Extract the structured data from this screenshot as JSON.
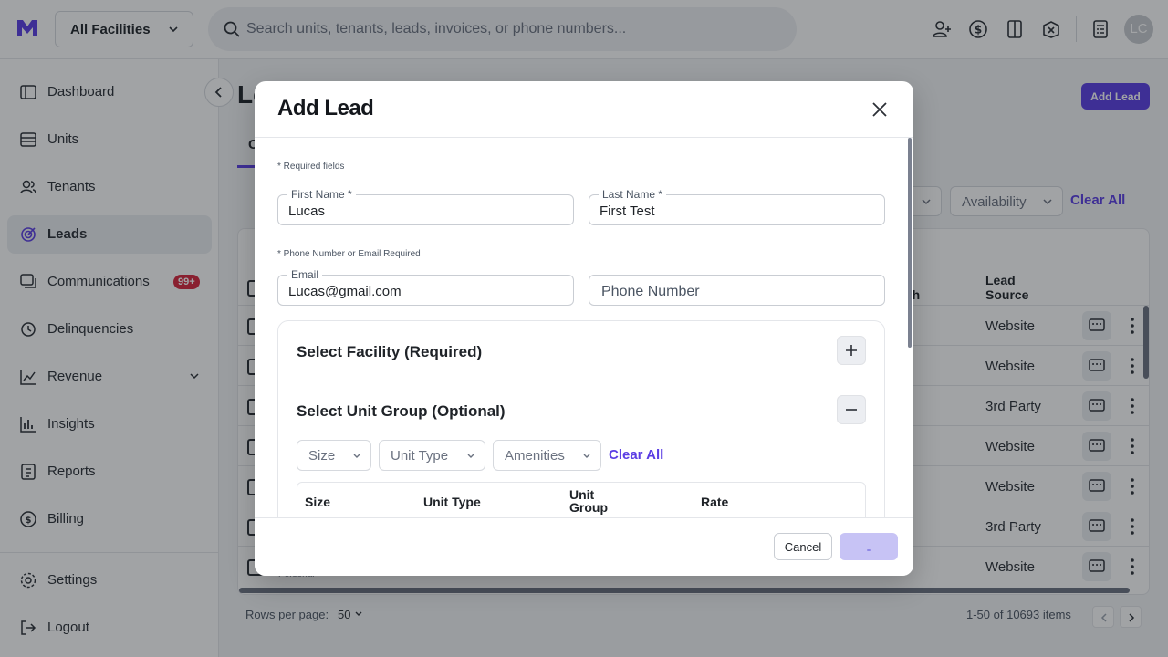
{
  "topbar": {
    "facility_select": "All Facilities",
    "search_placeholder": "Search units, tenants, leads, invoices, or phone numbers...",
    "user_initials": "LC",
    "icons": [
      "add-person-icon",
      "dollar-refresh-icon",
      "door-icon",
      "lock-box-icon",
      "calculator-icon"
    ]
  },
  "sidebar": {
    "items": [
      {
        "label": "Dashboard",
        "icon": "dashboard-icon"
      },
      {
        "label": "Units",
        "icon": "units-icon"
      },
      {
        "label": "Tenants",
        "icon": "tenants-icon"
      },
      {
        "label": "Leads",
        "icon": "leads-icon",
        "active": true
      },
      {
        "label": "Communications",
        "icon": "chat-icon",
        "badge": "99+"
      },
      {
        "label": "Delinquencies",
        "icon": "alarm-icon"
      },
      {
        "label": "Revenue",
        "icon": "trend-icon"
      },
      {
        "label": "Insights",
        "icon": "bar-chart-icon"
      },
      {
        "label": "Reports",
        "icon": "report-icon"
      },
      {
        "label": "Billing",
        "icon": "billing-icon"
      }
    ],
    "bottom_items": [
      {
        "label": "Settings",
        "icon": "gear-icon"
      },
      {
        "label": "Logout",
        "icon": "logout-icon"
      }
    ]
  },
  "main": {
    "title": "Le",
    "add_lead_button": "Add Lead",
    "tab_stub": "C",
    "filters": {
      "availability": "Availability",
      "clear_all": "Clear All"
    },
    "table": {
      "headers": {
        "reach": "ach",
        "lead_source": "Lead Source"
      },
      "rows": [
        {
          "lead_source": "Website"
        },
        {
          "lead_source": "Website"
        },
        {
          "lead_source": "3rd Party"
        },
        {
          "lead_source": "Website"
        },
        {
          "lead_source": "Website"
        },
        {
          "lead_source": "3rd Party"
        },
        {
          "lead_source": "Website"
        }
      ],
      "peek_text": "Personal"
    },
    "pagination": {
      "rows_per_page_label": "Rows per page:",
      "rows_per_page_value": "50",
      "info": "1-50 of 10693 items"
    }
  },
  "modal": {
    "title": "Add Lead",
    "required_note": "* Required fields",
    "first_name": {
      "label": "First Name *",
      "value": "Lucas"
    },
    "last_name": {
      "label": "Last Name *",
      "value": "First Test"
    },
    "contact_note": "* Phone Number or Email Required",
    "email": {
      "label": "Email",
      "value": "Lucas@gmail.com"
    },
    "phone": {
      "placeholder": "Phone Number"
    },
    "select_facility": "Select Facility (Required)",
    "select_unit_group": "Select Unit Group (Optional)",
    "unit_filters": {
      "size": "Size",
      "unit_type": "Unit Type",
      "amenities": "Amenities",
      "clear_all": "Clear All"
    },
    "unit_table_headers": {
      "size": "Size",
      "unit_type": "Unit Type",
      "unit_group": "Unit Group",
      "rate": "Rate"
    },
    "cancel_button": "Cancel"
  },
  "colors": {
    "accent": "#5b3ee4",
    "badge": "#d7263d",
    "submit_disabled": "#c7c3f5"
  }
}
